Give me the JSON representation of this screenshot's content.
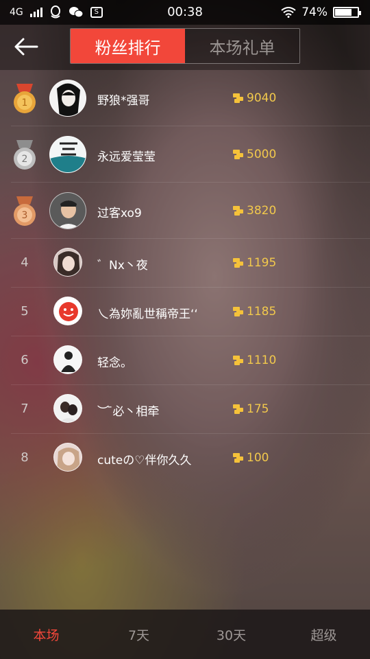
{
  "status_bar": {
    "network": "4G",
    "time": "00:38",
    "battery": "74%",
    "battery_level": 0.74
  },
  "header": {
    "tabs": [
      {
        "label": "粉丝排行",
        "active": true
      },
      {
        "label": "本场礼单",
        "active": false
      }
    ]
  },
  "rankings": [
    {
      "rank": "1",
      "name": "野狼*强哥",
      "score": "9040",
      "medal": "gold"
    },
    {
      "rank": "2",
      "name": "永远爱莹莹",
      "score": "5000",
      "medal": "silver"
    },
    {
      "rank": "3",
      "name": "过客xo9",
      "score": "3820",
      "medal": "bronze"
    },
    {
      "rank": "4",
      "name": "゛Nx丶夜",
      "score": "1195"
    },
    {
      "rank": "5",
      "name": "乀為妳亂世稱帝王‘‘",
      "score": "1185"
    },
    {
      "rank": "6",
      "name": "轻念。",
      "score": "1110"
    },
    {
      "rank": "7",
      "name": "︶ ̄必丶相牵",
      "score": "175"
    },
    {
      "rank": "8",
      "name": "cuteの♡伴你久久",
      "score": "100"
    }
  ],
  "bottom_nav": [
    {
      "label": "本场",
      "active": true
    },
    {
      "label": "7天",
      "active": false
    },
    {
      "label": "30天",
      "active": false
    },
    {
      "label": "超级",
      "active": false
    }
  ],
  "colors": {
    "accent": "#f2473a",
    "score": "#f2c94c",
    "gold": "#e8a53a",
    "silver": "#c9c9c9",
    "bronze": "#e29a66"
  }
}
